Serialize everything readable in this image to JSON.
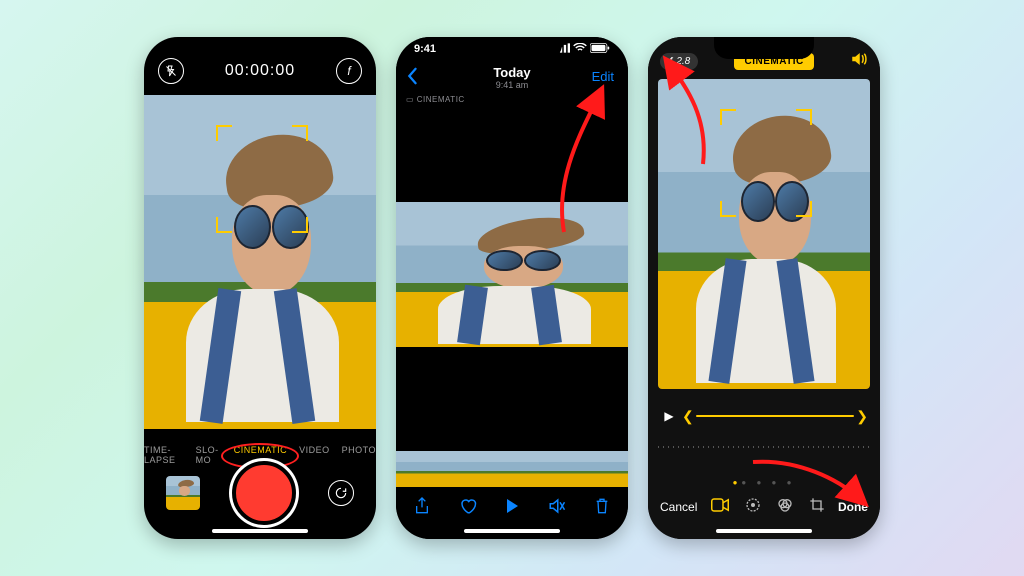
{
  "phone1": {
    "timer": "00:00:00",
    "modes": [
      "TIME-LAPSE",
      "SLO-MO",
      "CINEMATIC",
      "VIDEO",
      "PHOTO"
    ],
    "active_mode_index": 2
  },
  "phone2": {
    "status_time": "9:41",
    "title": "Today",
    "subtitle": "9:41 am",
    "edit_label": "Edit",
    "cinematic_tag": "▭ CINEMATIC"
  },
  "phone3": {
    "aperture_label": "ƒ 2.8",
    "badge": "CINEMATIC",
    "cancel_label": "Cancel",
    "done_label": "Done"
  }
}
